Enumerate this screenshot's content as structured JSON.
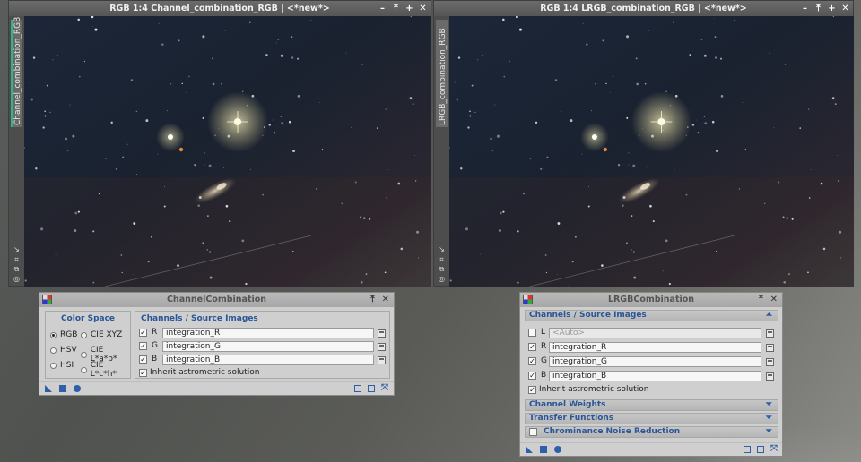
{
  "left_window": {
    "title": "RGB 1:4 Channel_combination_RGB | <*new*>",
    "side_label": "Channel_combination_RGB",
    "buttons": [
      "–",
      "⤒",
      "+",
      "✕"
    ]
  },
  "right_window": {
    "title": "RGB 1:4 LRGB_combination_RGB | <*new*>",
    "side_label": "LRGB_combination_RGB",
    "buttons": [
      "–",
      "⤒",
      "+",
      "✕"
    ]
  },
  "channel_combination": {
    "title": "ChannelCombination",
    "color_space": {
      "title": "Color Space",
      "options": [
        "RGB",
        "HSV",
        "HSI",
        "CIE XYZ",
        "CIE L*a*b*",
        "CIE L*c*h*"
      ],
      "selected": "RGB"
    },
    "channels": {
      "title": "Channels / Source Images",
      "rows": [
        {
          "channel": "R",
          "checked": true,
          "image": "integration_R"
        },
        {
          "channel": "G",
          "checked": true,
          "image": "integration_G"
        },
        {
          "channel": "B",
          "checked": true,
          "image": "integration_B"
        }
      ],
      "inherit_label": "Inherit astrometric solution",
      "inherit_checked": true
    }
  },
  "lrgb_combination": {
    "title": "LRGBCombination",
    "channels": {
      "title": "Channels / Source Images",
      "rows": [
        {
          "channel": "L",
          "checked": false,
          "image": "<Auto>",
          "disabled": true
        },
        {
          "channel": "R",
          "checked": true,
          "image": "integration_R"
        },
        {
          "channel": "G",
          "checked": true,
          "image": "integration_G"
        },
        {
          "channel": "B",
          "checked": true,
          "image": "integration_B"
        }
      ],
      "inherit_label": "Inherit astrometric solution",
      "inherit_checked": true
    },
    "sections": {
      "weights": "Channel Weights",
      "transfer": "Transfer Functions",
      "noise": "Chrominance Noise Reduction"
    }
  },
  "colors": {
    "accent_blue": "#2a5698",
    "panel_bg": "#cfcfcf",
    "sky_dark": "#1a2230",
    "selection_green": "#2fb58a"
  }
}
